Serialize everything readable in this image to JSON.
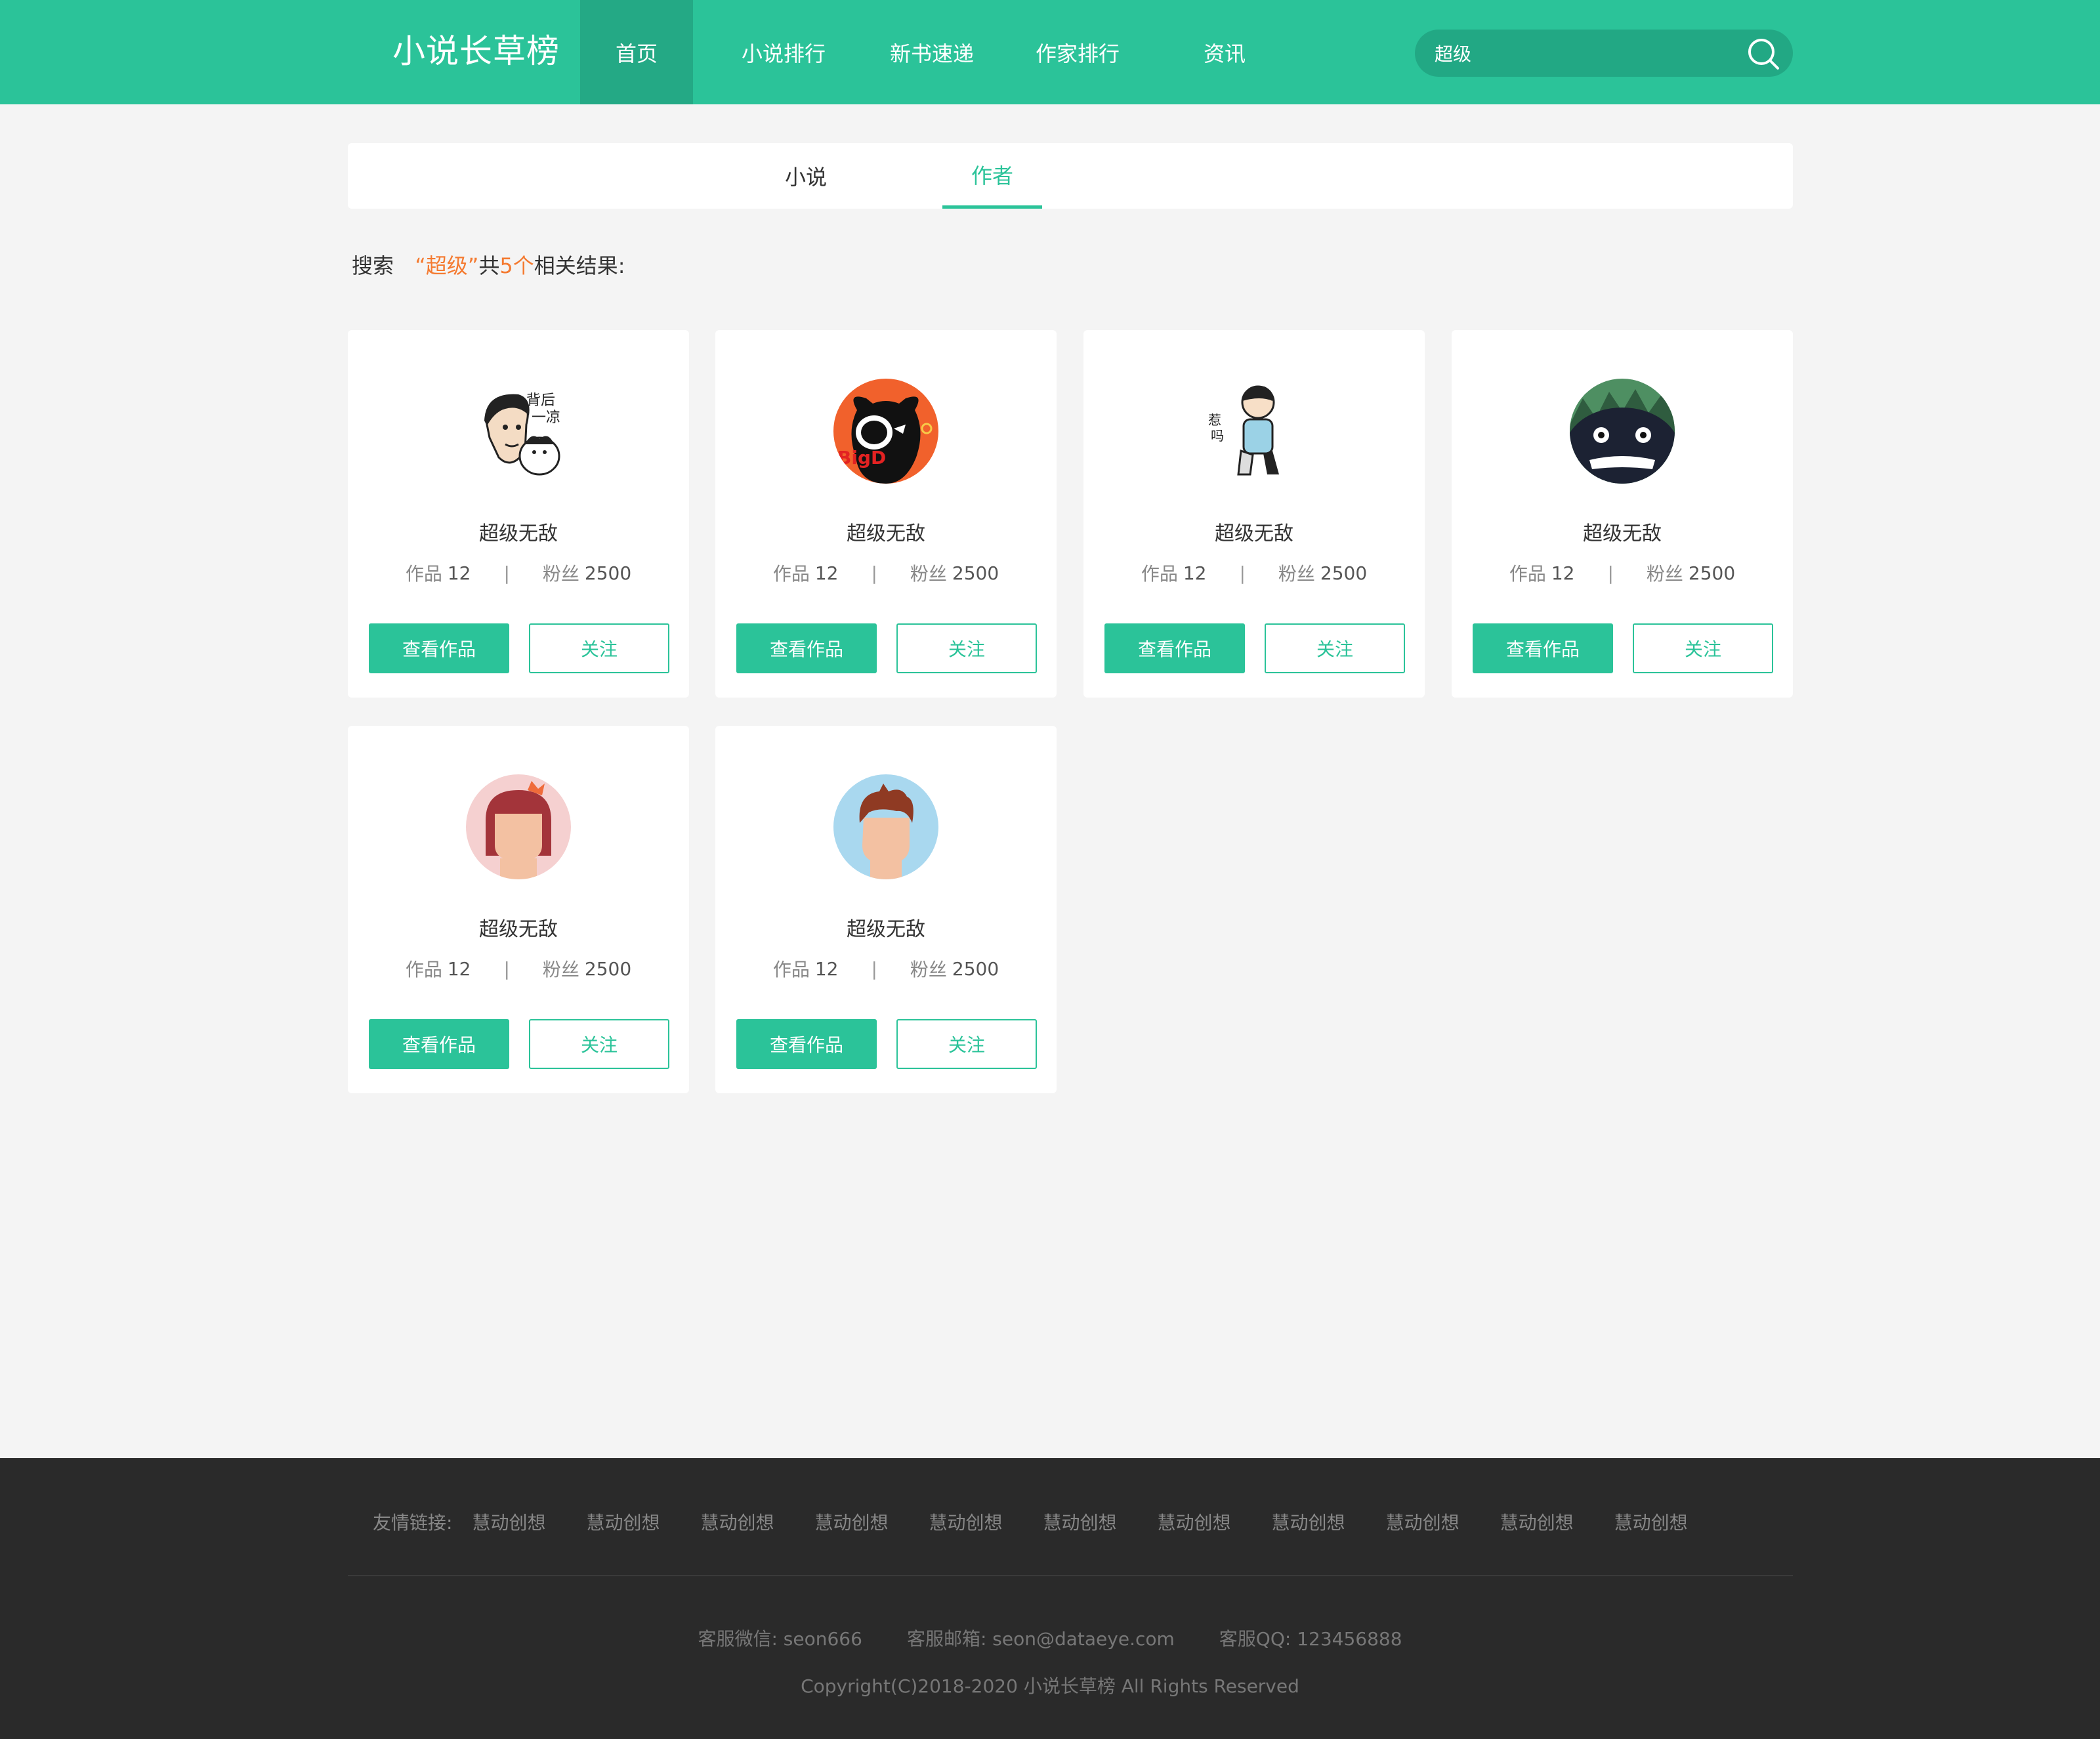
{
  "header": {
    "logo": "小说长草榜",
    "nav": [
      "首页",
      "小说排行",
      "新书速递",
      "作家排行",
      "资讯"
    ],
    "search_value": "超级"
  },
  "tabs": [
    "小说",
    "作者"
  ],
  "result": {
    "prefix": "搜索",
    "keyword": "“超级”",
    "mid": "共",
    "count": "5个",
    "suffix": "相关结果:"
  },
  "authors": [
    {
      "name": "超级无敌",
      "works_label": "作品",
      "works": "12",
      "fans_label": "粉丝",
      "fans": "2500",
      "avatar": "cartoon-man-cat-avatar"
    },
    {
      "name": "超级无敌",
      "works_label": "作品",
      "works": "12",
      "fans_label": "粉丝",
      "fans": "2500",
      "avatar": "bigd-black-goat-avatar"
    },
    {
      "name": "超级无敌",
      "works_label": "作品",
      "works": "12",
      "fans_label": "粉丝",
      "fans": "2500",
      "avatar": "cartoon-boy-sitting-avatar"
    },
    {
      "name": "超级无敌",
      "works_label": "作品",
      "works": "12",
      "fans_label": "粉丝",
      "fans": "2500",
      "avatar": "totoro-avatar"
    },
    {
      "name": "超级无敌",
      "works_label": "作品",
      "works": "12",
      "fans_label": "粉丝",
      "fans": "2500",
      "avatar": "girl-avatar"
    },
    {
      "name": "超级无敌",
      "works_label": "作品",
      "works": "12",
      "fans_label": "粉丝",
      "fans": "2500",
      "avatar": "boy-avatar"
    }
  ],
  "card_buttons": {
    "view": "查看作品",
    "follow": "关注"
  },
  "stats_separator": "|",
  "footer": {
    "links_label": "友情链接:",
    "links": [
      "慧动创想",
      "慧动创想",
      "慧动创想",
      "慧动创想",
      "慧动创想",
      "慧动创想",
      "慧动创想",
      "慧动创想",
      "慧动创想",
      "慧动创想",
      "慧动创想"
    ],
    "wechat": "客服微信: seon666",
    "email": "客服邮箱: seon@dataeye.com",
    "qq": "客服QQ: 123456888",
    "copyright": "Copyright(C)2018-2020 小说长草榜 All Rights Reserved"
  },
  "colors": {
    "accent": "#2bc399",
    "highlight": "#f47a30",
    "footer_bg": "#2a2a2a"
  }
}
